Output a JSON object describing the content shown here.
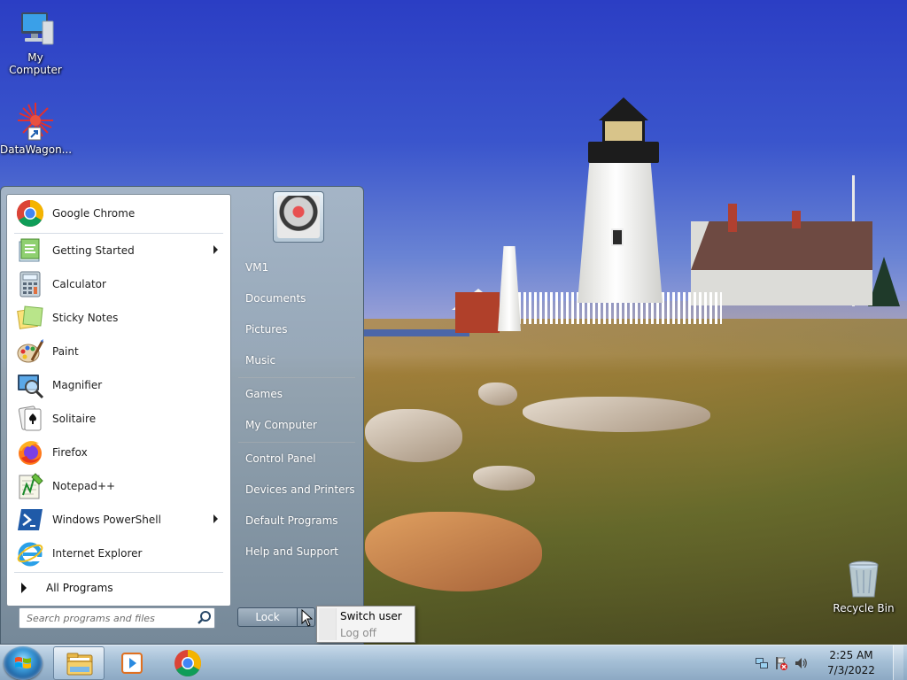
{
  "desktop": {
    "icons": [
      {
        "label": "My Computer"
      },
      {
        "label": "DataWagon..."
      },
      {
        "label": "Recycle Bin"
      }
    ]
  },
  "start_menu": {
    "programs": [
      {
        "label": "Google Chrome",
        "icon": "chrome-icon",
        "submenu": false
      },
      {
        "label": "Getting Started",
        "icon": "getting-started-icon",
        "submenu": true
      },
      {
        "label": "Calculator",
        "icon": "calculator-icon",
        "submenu": false
      },
      {
        "label": "Sticky Notes",
        "icon": "sticky-notes-icon",
        "submenu": false
      },
      {
        "label": "Paint",
        "icon": "paint-icon",
        "submenu": false
      },
      {
        "label": "Magnifier",
        "icon": "magnifier-icon",
        "submenu": false
      },
      {
        "label": "Solitaire",
        "icon": "solitaire-icon",
        "submenu": false
      },
      {
        "label": "Firefox",
        "icon": "firefox-icon",
        "submenu": false
      },
      {
        "label": "Notepad++",
        "icon": "notepad-plus-plus-icon",
        "submenu": false
      },
      {
        "label": "Windows PowerShell",
        "icon": "powershell-icon",
        "submenu": true
      },
      {
        "label": "Internet Explorer",
        "icon": "internet-explorer-icon",
        "submenu": false
      }
    ],
    "all_programs": "All Programs",
    "search": {
      "placeholder": "Search programs and files"
    },
    "right_links": [
      {
        "label": "VM1"
      },
      {
        "label": "Documents"
      },
      {
        "label": "Pictures"
      },
      {
        "label": "Music"
      },
      {
        "label": "Games"
      },
      {
        "label": "My Computer"
      },
      {
        "label": "Control Panel"
      },
      {
        "label": "Devices and Printers"
      },
      {
        "label": "Default Programs"
      },
      {
        "label": "Help and Support"
      }
    ],
    "lock_label": "Lock",
    "power_menu": [
      {
        "label": "Switch user",
        "enabled": true
      },
      {
        "label": "Log off",
        "enabled": false
      }
    ]
  },
  "taskbar": {
    "pinned": [
      {
        "icon": "explorer-folder-icon",
        "active": true
      },
      {
        "icon": "media-player-icon",
        "active": false
      },
      {
        "icon": "chrome-icon",
        "active": false
      }
    ],
    "clock": {
      "time": "2:25 AM",
      "date": "7/3/2022"
    }
  },
  "colors": {
    "start_orb": "#3b9ad8",
    "chrome_red": "#db4437",
    "chrome_yellow": "#f4b400",
    "chrome_green": "#0f9d58",
    "chrome_blue": "#4285f4"
  }
}
